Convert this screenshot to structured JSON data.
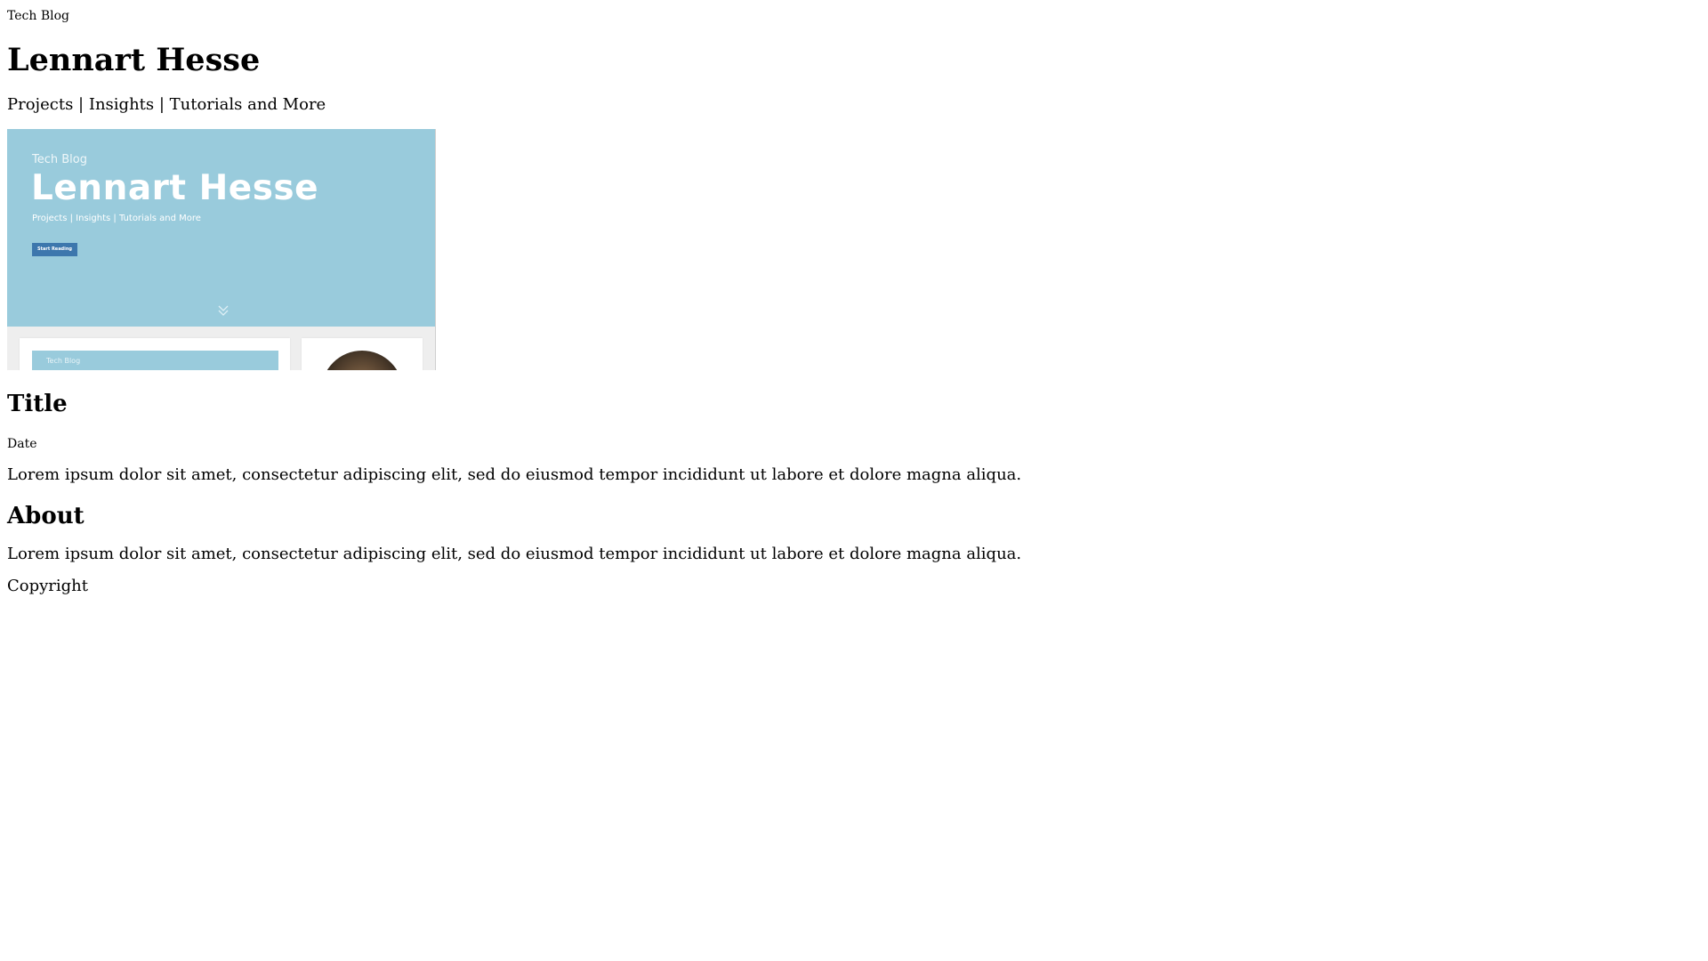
{
  "header": {
    "tag": "Tech Blog",
    "title": "Lennart Hesse",
    "subtitle": "Projects | Insights | Tutorials and More"
  },
  "preview": {
    "tag": "Tech Blog",
    "title": "Lennart Hesse",
    "subtitle": "Projects | Insights | Tutorials and More",
    "button_label": "Start Reading",
    "card_tag": "Tech Blog",
    "colors": {
      "hero_background": "#99cbdc",
      "button_background": "#3d77ad"
    }
  },
  "post": {
    "title": "Title",
    "date": "Date",
    "body": "Lorem ipsum dolor sit amet, consectetur adipiscing elit, sed do eiusmod tempor incididunt ut labore et dolore magna aliqua."
  },
  "about": {
    "title": "About",
    "body": "Lorem ipsum dolor sit amet, consectetur adipiscing elit, sed do eiusmod tempor incididunt ut labore et dolore magna aliqua."
  },
  "footer": {
    "copyright": "Copyright"
  }
}
